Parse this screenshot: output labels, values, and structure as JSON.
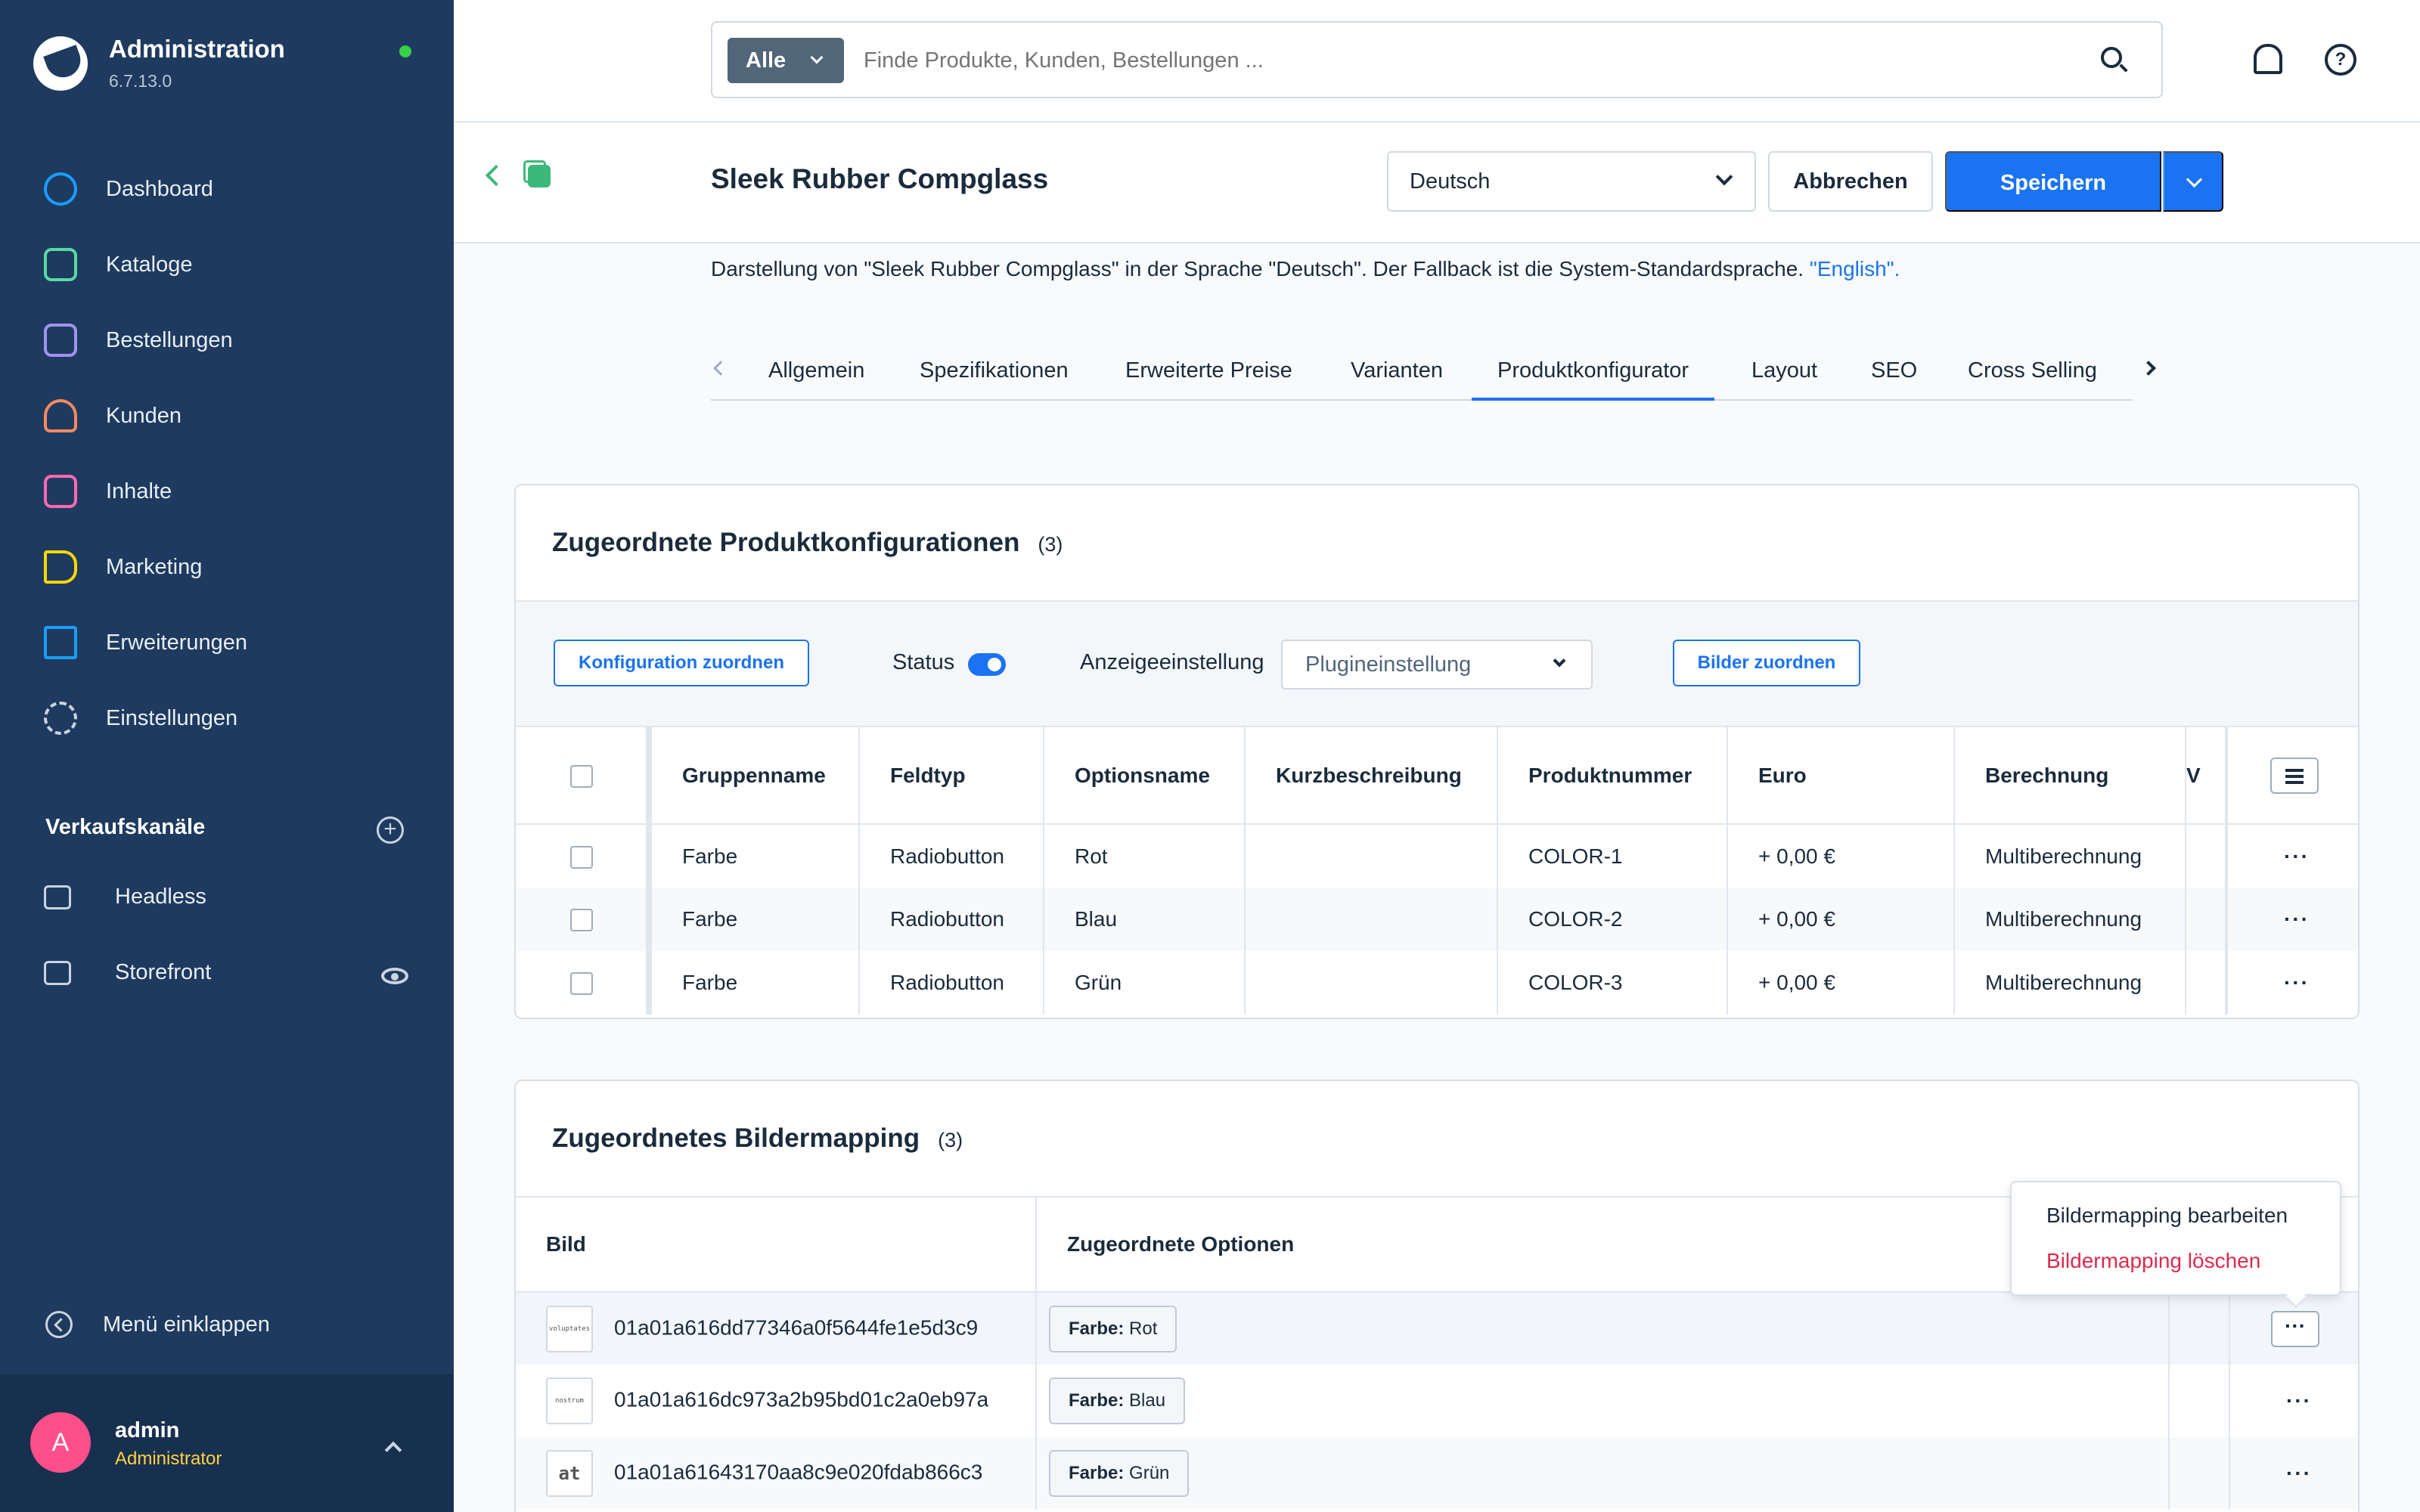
{
  "app": {
    "title": "Administration",
    "version": "6.7.13.0"
  },
  "sidebar": {
    "items": [
      {
        "label": "Dashboard",
        "icon": "dashboard-icon",
        "color": "#189eff"
      },
      {
        "label": "Kataloge",
        "icon": "catalog-icon",
        "color": "#57d9a3"
      },
      {
        "label": "Bestellungen",
        "icon": "orders-icon",
        "color": "#a092f0"
      },
      {
        "label": "Kunden",
        "icon": "customers-icon",
        "color": "#f88962"
      },
      {
        "label": "Inhalte",
        "icon": "content-icon",
        "color": "#ff68b4"
      },
      {
        "label": "Marketing",
        "icon": "marketing-icon",
        "color": "#ffd700"
      },
      {
        "label": "Erweiterungen",
        "icon": "extensions-icon",
        "color": "#189eff"
      },
      {
        "label": "Einstellungen",
        "icon": "settings-icon",
        "color": "#c9d4e0"
      }
    ],
    "sales_channels_title": "Verkaufskanäle",
    "sales_channels": [
      {
        "label": "Headless",
        "icon": "basket-icon"
      },
      {
        "label": "Storefront",
        "icon": "storefront-icon"
      }
    ],
    "collapse_label": "Menü einklappen",
    "user": {
      "initial": "A",
      "name": "admin",
      "role": "Administrator"
    }
  },
  "header": {
    "search_type": "Alle",
    "search_placeholder": "Finde Produkte, Kunden, Bestellungen ..."
  },
  "page": {
    "title": "Sleek Rubber Compglass",
    "language": "Deutsch",
    "cancel_label": "Abbrechen",
    "save_label": "Speichern",
    "fallback_text": "Darstellung von \"Sleek Rubber Compglass\" in der Sprache \"Deutsch\". Der Fallback ist die System-Standardsprache. ",
    "fallback_link": "\"English\"."
  },
  "tabs": [
    {
      "label": "Allgemein",
      "active": false
    },
    {
      "label": "Spezifikationen",
      "active": false
    },
    {
      "label": "Erweiterte Preise",
      "active": false
    },
    {
      "label": "Varianten",
      "active": false
    },
    {
      "label": "Produktkonfigurator",
      "active": true
    },
    {
      "label": "Layout",
      "active": false
    },
    {
      "label": "SEO",
      "active": false
    },
    {
      "label": "Cross Selling",
      "active": false
    }
  ],
  "configurations": {
    "title": "Zugeordnete Produktkonfigurationen",
    "count": "(3)",
    "assign_button": "Konfiguration zuordnen",
    "status_label": "Status",
    "status_on": true,
    "display_label": "Anzeigeeinstellung",
    "display_value": "Plugineinstellung",
    "images_button": "Bilder zuordnen",
    "columns": [
      "Gruppenname",
      "Feldtyp",
      "Optionsname",
      "Kurzbeschreibung",
      "Produktnummer",
      "Euro",
      "Berechnung",
      "V"
    ],
    "rows": [
      {
        "group": "Farbe",
        "field_type": "Radiobutton",
        "option": "Rot",
        "short": "",
        "number": "COLOR-1",
        "euro": "+ 0,00 €",
        "calc": "Multiberechnung"
      },
      {
        "group": "Farbe",
        "field_type": "Radiobutton",
        "option": "Blau",
        "short": "",
        "number": "COLOR-2",
        "euro": "+ 0,00 €",
        "calc": "Multiberechnung"
      },
      {
        "group": "Farbe",
        "field_type": "Radiobutton",
        "option": "Grün",
        "short": "",
        "number": "COLOR-3",
        "euro": "+ 0,00 €",
        "calc": "Multiberechnung"
      }
    ],
    "row_action": "···"
  },
  "image_mapping": {
    "title": "Zugeordnetes Bildermapping",
    "count": "(3)",
    "columns": [
      "Bild",
      "Zugeordnete Optionen"
    ],
    "rows": [
      {
        "thumb": "voluptates",
        "id": "01a01a616dd77346a0f5644fe1e5d3c9",
        "tag_key": "Farbe:",
        "tag_value": " Rot"
      },
      {
        "thumb": "nostrum",
        "id": "01a01a616dc973a2b95bd01c2a0eb97a",
        "tag_key": "Farbe:",
        "tag_value": " Blau"
      },
      {
        "thumb": "at",
        "id": "01a01a61643170aa8c9e020fdab866c3",
        "tag_key": "Farbe:",
        "tag_value": " Grün"
      }
    ],
    "row_action": "···",
    "context_menu": {
      "edit": "Bildermapping bearbeiten",
      "delete": "Bildermapping löschen"
    }
  }
}
